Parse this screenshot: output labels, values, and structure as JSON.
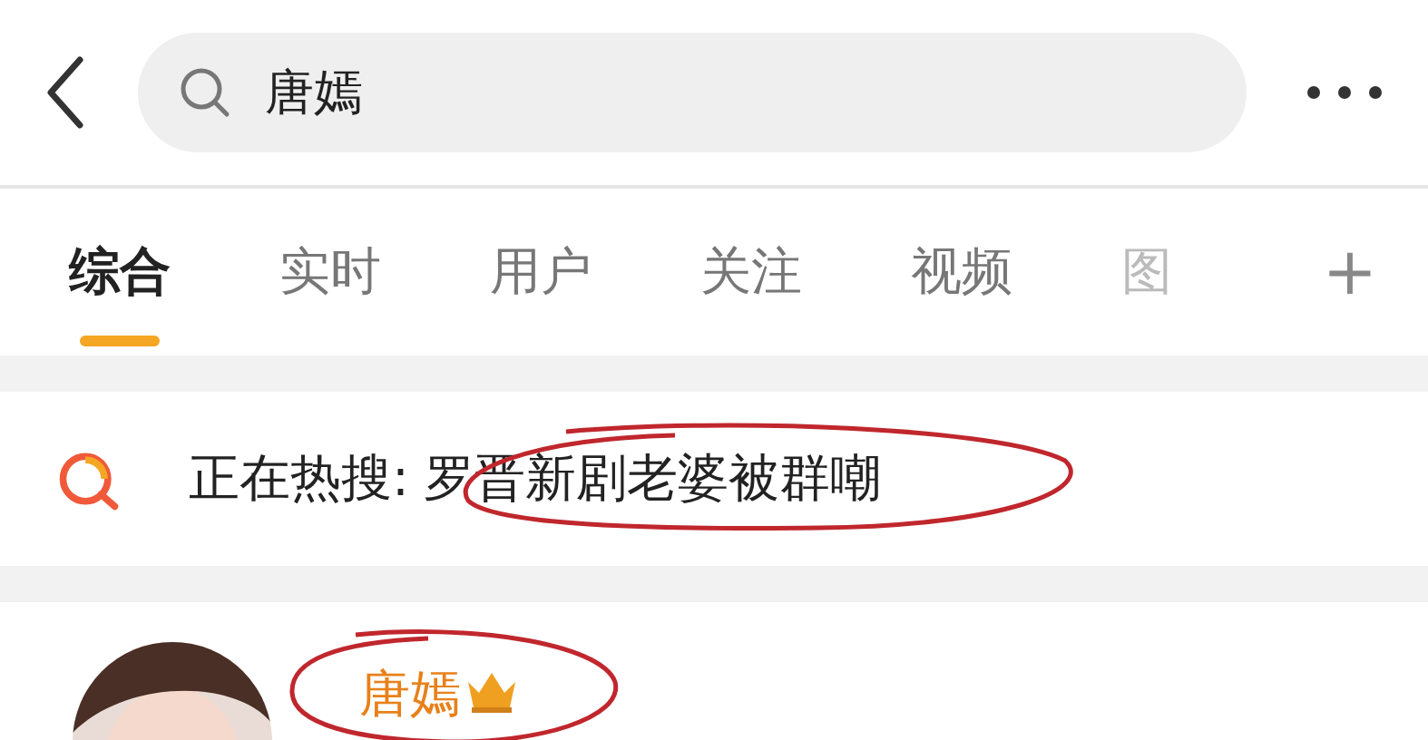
{
  "search": {
    "value": "唐嫣"
  },
  "tabs": [
    {
      "label": "综合",
      "selected": true
    },
    {
      "label": "实时",
      "selected": false
    },
    {
      "label": "用户",
      "selected": false
    },
    {
      "label": "关注",
      "selected": false
    },
    {
      "label": "视频",
      "selected": false
    },
    {
      "label": "图",
      "selected": false
    }
  ],
  "add_tab": "+",
  "hot_search": {
    "label": "正在热搜:",
    "topic": "罗晋新剧老婆被群嘲"
  },
  "user": {
    "name": "唐嫣"
  }
}
